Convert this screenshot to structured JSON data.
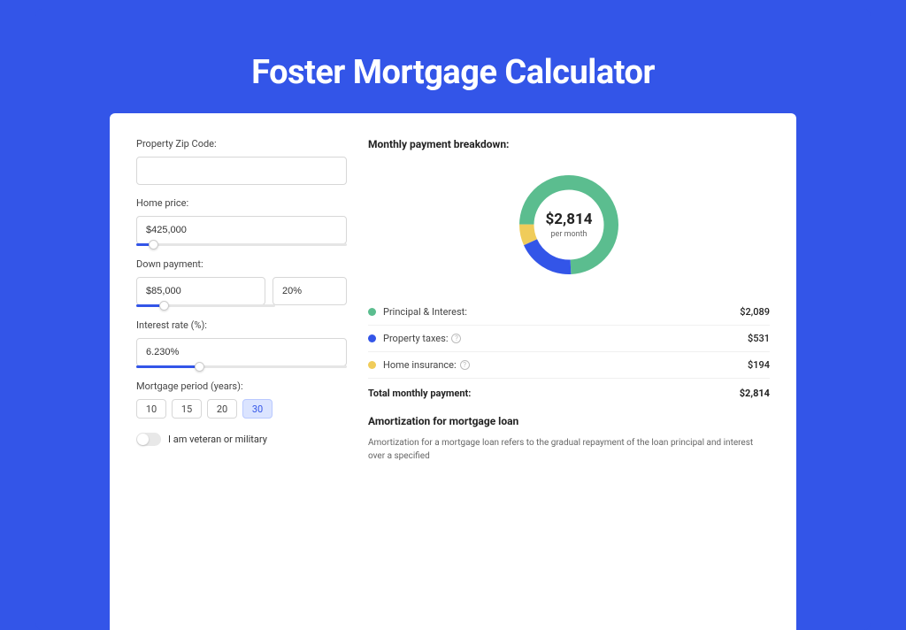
{
  "title": "Foster Mortgage Calculator",
  "left": {
    "zip_label": "Property Zip Code:",
    "zip_value": "",
    "home_price_label": "Home price:",
    "home_price_value": "$425,000",
    "home_price_slider_pct": 8,
    "down_payment_label": "Down payment:",
    "down_payment_amount": "$85,000",
    "down_payment_percent": "20%",
    "down_payment_slider_pct": 20,
    "interest_label": "Interest rate (%):",
    "interest_value": "6.230%",
    "interest_slider_pct": 30,
    "period_label": "Mortgage period (years):",
    "periods": [
      {
        "label": "10",
        "active": false
      },
      {
        "label": "15",
        "active": false
      },
      {
        "label": "20",
        "active": false
      },
      {
        "label": "30",
        "active": true
      }
    ],
    "veteran_label": "I am veteran or military",
    "veteran_on": false
  },
  "right": {
    "breakdown_title": "Monthly payment breakdown:",
    "donut_value": "$2,814",
    "donut_sub": "per month",
    "rows": [
      {
        "dot": "green",
        "label": "Principal & Interest:",
        "info": false,
        "value": "$2,089"
      },
      {
        "dot": "blue",
        "label": "Property taxes:",
        "info": true,
        "value": "$531"
      },
      {
        "dot": "yellow",
        "label": "Home insurance:",
        "info": true,
        "value": "$194"
      }
    ],
    "total_label": "Total monthly payment:",
    "total_value": "$2,814",
    "amort_title": "Amortization for mortgage loan",
    "amort_text": "Amortization for a mortgage loan refers to the gradual repayment of the loan principal and interest over a specified"
  },
  "chart_data": {
    "type": "pie",
    "title": "Monthly payment breakdown",
    "series": [
      {
        "name": "Principal & Interest",
        "value": 2089,
        "color": "#5bbd8f"
      },
      {
        "name": "Property taxes",
        "value": 531,
        "color": "#3355e8"
      },
      {
        "name": "Home insurance",
        "value": 194,
        "color": "#f0cc5a"
      }
    ],
    "total": 2814,
    "center_label": "$2,814 per month"
  }
}
